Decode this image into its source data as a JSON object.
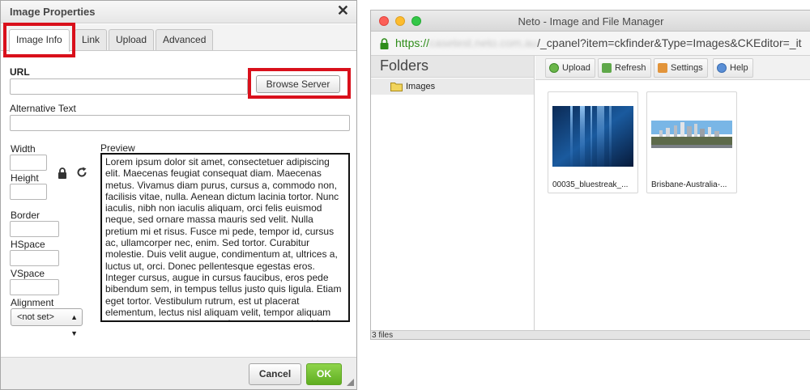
{
  "dialog": {
    "title": "Image Properties",
    "close_glyph": "✕",
    "tabs": [
      {
        "label": "Image Info",
        "active": true
      },
      {
        "label": "Link",
        "active": false
      },
      {
        "label": "Upload",
        "active": false
      },
      {
        "label": "Advanced",
        "active": false
      }
    ],
    "url_label": "URL",
    "url_value": "",
    "browse_button": "Browse Server",
    "alt_label": "Alternative Text",
    "alt_value": "",
    "width_label": "Width",
    "height_label": "Height",
    "border_label": "Border",
    "hspace_label": "HSpace",
    "vspace_label": "VSpace",
    "alignment_label": "Alignment",
    "alignment_value": "<not set>",
    "preview_label": "Preview",
    "preview_text": "Lorem ipsum dolor sit amet, consectetuer adipiscing elit. Maecenas feugiat consequat diam. Maecenas metus. Vivamus diam purus, cursus a, commodo non, facilisis vitae, nulla. Aenean dictum lacinia tortor. Nunc iaculis, nibh non iaculis aliquam, orci felis euismod neque, sed ornare massa mauris sed velit. Nulla pretium mi et risus. Fusce mi pede, tempor id, cursus ac, ullamcorper nec, enim. Sed tortor. Curabitur molestie. Duis velit augue, condimentum at, ultrices a, luctus ut, orci. Donec pellentesque egestas eros. Integer cursus, augue in cursus faucibus, eros pede bibendum sem, in tempus tellus justo quis ligula. Etiam eget tortor. Vestibulum rutrum, est ut placerat elementum, lectus nisl aliquam velit, tempor aliquam eros nunc nonummy metus. In eros metus, gravida a, gravida sed, lobortis id, turpis. Ut ultrices, ipsum at venenatis fringilla, sem nulla lacinia tellus, eget aliquet turpis mauris non enim.",
    "cancel_button": "Cancel",
    "ok_button": "OK",
    "highlight_color": "#d9101b"
  },
  "browser": {
    "window_title": "Neto - Image and File Manager",
    "url_scheme": "https://",
    "url_host_blurred": "casetest.neto.com.au",
    "url_path": "/_cpanel?item=ckfinder&Type=Images&CKEditor=_it",
    "folders_heading": "Folders",
    "folders": [
      {
        "name": "Images",
        "icon": "folder-icon"
      }
    ],
    "toolbar": [
      {
        "label": "Upload",
        "icon": "upload-icon"
      },
      {
        "label": "Refresh",
        "icon": "refresh-icon"
      },
      {
        "label": "Settings",
        "icon": "settings-icon"
      },
      {
        "label": "Help",
        "icon": "help-icon"
      }
    ],
    "files": [
      {
        "name": "00035_bluestreak_...",
        "thumb": "blue-streak-image"
      },
      {
        "name": "Brisbane-Australia-...",
        "thumb": "city-skyline-image"
      }
    ],
    "status": "3 files",
    "traffic_lights": [
      "#fc5f57",
      "#fdbc2e",
      "#33c748"
    ],
    "url_scheme_color": "#2e8d19"
  }
}
